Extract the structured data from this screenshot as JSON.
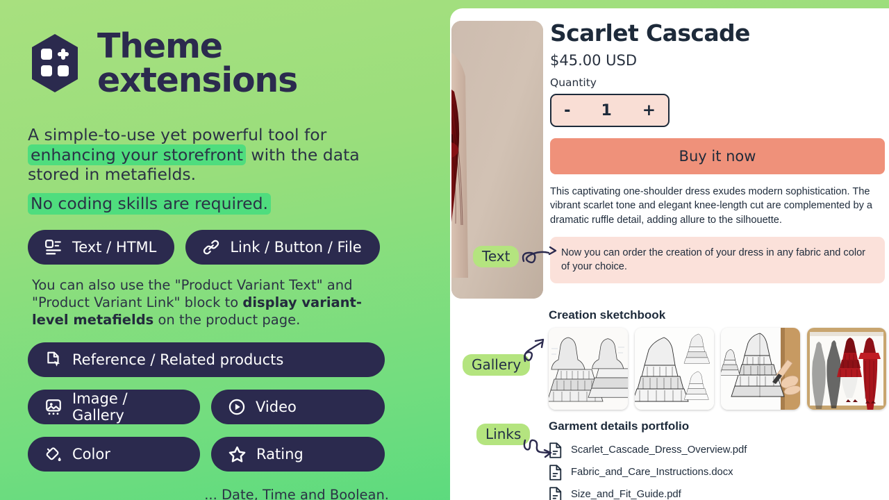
{
  "promo": {
    "logo_icon": "grid-plus-hexagon-logo",
    "title": "Theme extensions",
    "lead_before": "A simple-to-use yet powerful tool for ",
    "lead_highlight": "enhancing your storefront",
    "lead_after": " with the data stored in metafields.",
    "lead_line2": "No coding skills  are required.",
    "note_before": "You can also use the \"Product Variant Text\" and \"Product Variant Link\" block to ",
    "note_bold": "display variant-level metafields",
    "note_after": " on the product page.",
    "footnote": "... Date, Time and Boolean.",
    "blocks": [
      {
        "label": "Text / HTML",
        "icon": "text-html-icon"
      },
      {
        "label": "Link / Button / File",
        "icon": "link-chain-icon"
      },
      {
        "label": "Reference / Related products",
        "icon": "document-cursor-icon"
      },
      {
        "label": "Image / Gallery",
        "icon": "image-gallery-icon"
      },
      {
        "label": "Video",
        "icon": "play-circle-icon"
      },
      {
        "label": "Color",
        "icon": "paint-bucket-icon"
      },
      {
        "label": "Rating",
        "icon": "star-icon"
      }
    ]
  },
  "product": {
    "title": "Scarlet Cascade",
    "price": "$45.00 USD",
    "quantity_label": "Quantity",
    "quantity_minus": "-",
    "quantity_value": "1",
    "quantity_plus": "+",
    "buy_label": "Buy it now",
    "description": "This captivating one-shoulder dress exudes modern sophistication. The vibrant scarlet tone and elegant knee-length cut are complemented by a dramatic ruffle detail, adding allure to the silhouette.",
    "callout": "Now you can order the creation of your dress in any fabric and color of your choice.",
    "gallery_heading": "Creation sketchbook",
    "gallery_items": [
      "dress-sketch-technical-pair",
      "dress-sketch-ruffle-trio",
      "dress-sketch-hand-drawing",
      "dress-sketch-red-fashion-row"
    ],
    "files_heading": "Garment details portfolio",
    "files": [
      {
        "name": "Scarlet_Cascade_Dress_Overview.pdf",
        "icon": "file-document-icon"
      },
      {
        "name": "Fabric_and_Care_Instructions.docx",
        "icon": "file-document-icon"
      },
      {
        "name": "Size_and_Fit_Guide.pdf",
        "icon": "file-document-icon"
      }
    ]
  },
  "annotations": [
    {
      "label": "Text"
    },
    {
      "label": "Gallery"
    },
    {
      "label": "Links"
    }
  ],
  "colors": {
    "bg_green_top": "#a8e07f",
    "bg_green_bottom": "#4fd97e",
    "highlight_green": "#4fdd7e",
    "badge_green": "#b4e47f",
    "navy": "#2b2a4e",
    "ink": "#1d2a3a",
    "coral": "#ef917a",
    "blush": "#f9ded5",
    "callout_pink": "#fbe1da"
  }
}
